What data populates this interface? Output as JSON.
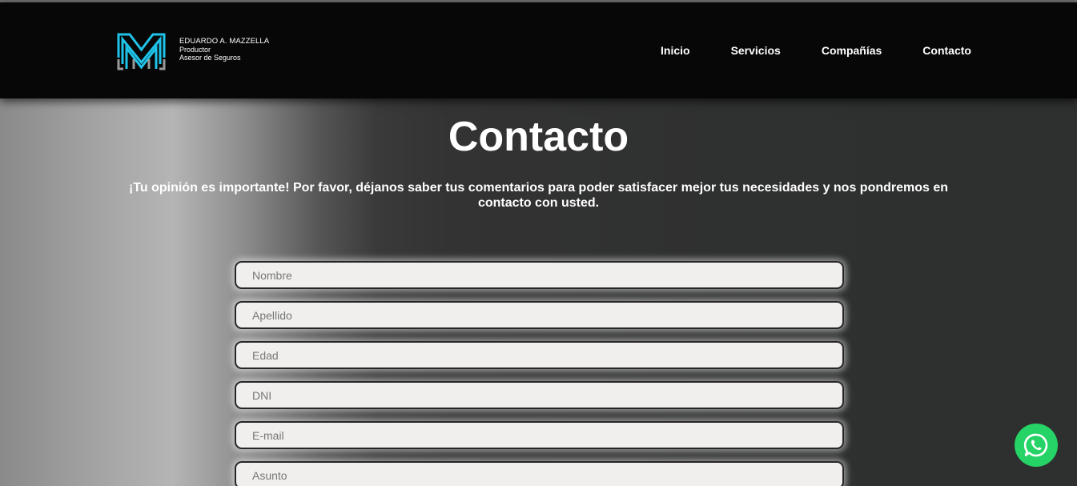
{
  "brand": {
    "name": "EDUARDO A. MAZZELLA",
    "line2": "Productor",
    "line3": "Asesor de Seguros"
  },
  "nav": {
    "items": [
      {
        "label": "Inicio"
      },
      {
        "label": "Servicios"
      },
      {
        "label": "Compañías"
      },
      {
        "label": "Contacto"
      }
    ]
  },
  "page": {
    "title": "Contacto",
    "lead": "¡Tu opinión es importante! Por favor, déjanos saber tus comentarios para poder satisfacer mejor tus necesidades y nos pondremos en contacto con usted."
  },
  "form": {
    "fields": [
      {
        "placeholder": "Nombre",
        "value": ""
      },
      {
        "placeholder": "Apellido",
        "value": ""
      },
      {
        "placeholder": "Edad",
        "value": ""
      },
      {
        "placeholder": "DNI",
        "value": ""
      },
      {
        "placeholder": "E-mail",
        "value": ""
      },
      {
        "placeholder": "Asunto",
        "value": ""
      }
    ]
  },
  "icons": {
    "logo": "m-monogram-logo",
    "whatsapp": "whatsapp-icon"
  },
  "colors": {
    "header_bg": "#070707",
    "logo_accent": "#1fc3e8",
    "whatsapp": "#25d366",
    "field_bg": "#f0efed"
  }
}
